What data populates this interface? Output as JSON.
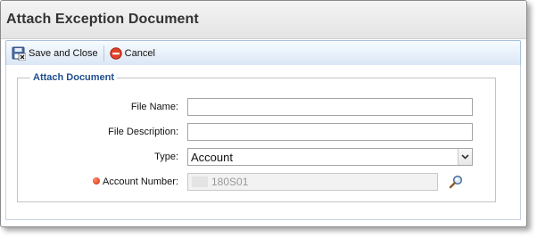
{
  "window": {
    "title": "Attach Exception Document"
  },
  "toolbar": {
    "save_close_label": "Save and Close",
    "cancel_label": "Cancel"
  },
  "form": {
    "group_title": "Attach Document",
    "file_name": {
      "label": "File Name:",
      "value": ""
    },
    "file_description": {
      "label": "File Description:",
      "value": ""
    },
    "type": {
      "label": "Type:",
      "selected": "Account"
    },
    "account_number": {
      "label": "Account Number:",
      "value": "180S01",
      "required": true
    }
  },
  "icons": {
    "save_close": "save-close-icon",
    "cancel": "cancel-icon",
    "lookup": "magnifier-icon",
    "required": "required-dot-icon",
    "dropdown": "chevron-down-icon"
  }
}
